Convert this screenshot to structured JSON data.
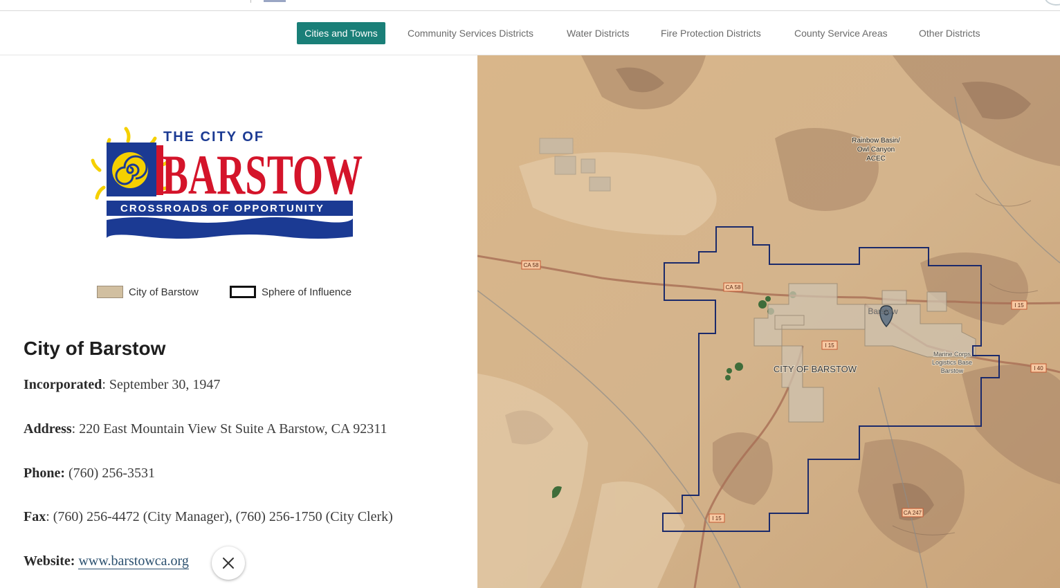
{
  "nav": {
    "items": [
      {
        "label": "Cities and Towns",
        "active": true
      },
      {
        "label": "Community Services Districts",
        "active": false
      },
      {
        "label": "Water Districts",
        "active": false
      },
      {
        "label": "Fire Protection Districts",
        "active": false
      },
      {
        "label": "County Service Areas",
        "active": false
      },
      {
        "label": "Other Districts",
        "active": false
      }
    ],
    "accent_color": "#1a7f78"
  },
  "logo": {
    "line1": "THE CITY OF",
    "line2": "BARSTOW",
    "line3": "CROSSROADS OF OPPORTUNITY",
    "colors": {
      "blue": "#1b3a93",
      "red": "#d4142a",
      "yellow": "#f5d000"
    }
  },
  "legend": {
    "city_label": "City of Barstow",
    "sphere_label": "Sphere of Influence",
    "city_color": "#d1bfa0",
    "sphere_color": "#111111"
  },
  "city": {
    "title": "City of Barstow",
    "incorporated_label": "Incorporated",
    "incorporated_value": ": September 30, 1947",
    "address_label": "Address",
    "address_value": ": 220 East Mountain View St Suite A Barstow, CA 92311",
    "phone_label": "Phone:",
    "phone_value": " (760) 256-3531",
    "fax_label": "Fax",
    "fax_value": ": (760) 256-4472 (City Manager), (760) 256-1750 (City Clerk)",
    "website_label": "Website:",
    "website_value": "www.barstowca.org"
  },
  "close": {
    "icon": "close-icon"
  },
  "map": {
    "labels": {
      "aoi_line1": "Rainbow Basin/",
      "aoi_line2": "Owl Canyon",
      "aoi_line3": "ACEC",
      "city_label": "CITY OF BARSTOW",
      "barstow_label": "Barstow",
      "marine_line1": "Marine Corps",
      "marine_line2": "Logistics Base",
      "marine_line3": "Barstow"
    },
    "roads": {
      "ca58_a": "CA 58",
      "ca58_b": "CA 58",
      "i15_a": "I 15",
      "i15_b": "I 15",
      "i15_c": "I 15",
      "i40": "I 40",
      "ca247": "CA 247"
    },
    "colors": {
      "sphere_outline": "#1b2a6b",
      "city_fill": "#cfc3b0",
      "terrain": "#d4b48c"
    }
  }
}
